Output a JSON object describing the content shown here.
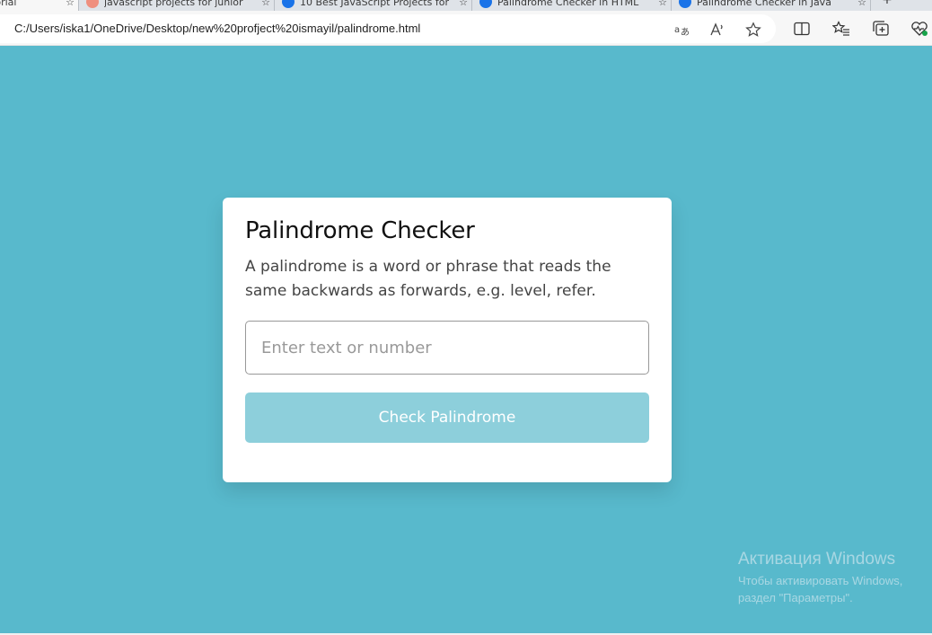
{
  "browser": {
    "tabs": [
      {
        "label": "Tutorial",
        "favicon": "page-icon",
        "active": true
      },
      {
        "label": "javascript projects for junior",
        "favicon": "red-globe-icon",
        "active": false
      },
      {
        "label": "10 Best JavaScript Projects for",
        "favicon": "edge-icon",
        "active": false
      },
      {
        "label": "Palindrome Checker in HTML",
        "favicon": "edge-icon",
        "active": false
      },
      {
        "label": "Palindrome Checker in Java",
        "favicon": "edge-icon",
        "active": false
      }
    ],
    "address_url": "C:/Users/iska1/OneDrive/Desktop/new%20profject%20ismayil/palindrome.html",
    "address_icons": [
      "translate-icon",
      "read-aloud-icon",
      "favorite-star-icon"
    ],
    "toolbar_icons": [
      "split-screen-icon",
      "favorites-icon",
      "collections-icon",
      "browser-essentials-icon"
    ]
  },
  "page": {
    "background_color": "#58b9cc",
    "card": {
      "title": "Palindrome Checker",
      "description": "A palindrome is a word or phrase that reads the same backwards as forwards, e.g. level, refer.",
      "input_placeholder": "Enter text or number",
      "input_value": "",
      "button_label": "Check Palindrome",
      "button_color": "#8dcfdb"
    }
  },
  "watermark": {
    "title": "Активация Windows",
    "line1": "Чтобы активировать Windows,",
    "line2": "раздел \"Параметры\"."
  }
}
